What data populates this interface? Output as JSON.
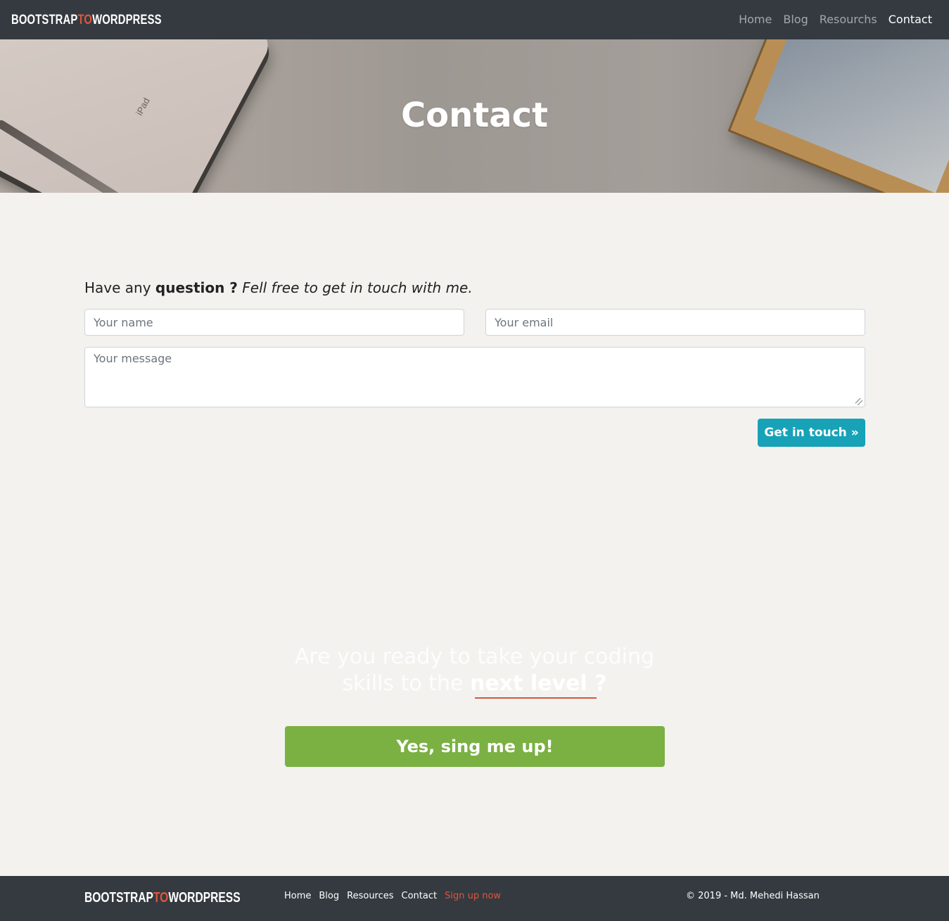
{
  "navbar": {
    "brand_part1": "BOOTSTRAP",
    "brand_accent": "TO",
    "brand_part2": "WORDPRESS",
    "links": [
      {
        "label": "Home"
      },
      {
        "label": "Blog"
      },
      {
        "label": "Resourchs"
      },
      {
        "label": "Contact",
        "active": true
      }
    ]
  },
  "hero": {
    "title": "Contact",
    "ipad_text": "iPad"
  },
  "contact": {
    "intro_prefix": "Have any ",
    "intro_bold": "question ?",
    "intro_italic": " Fell free to get in touch with me.",
    "name_placeholder": "Your name",
    "email_placeholder": "Your email",
    "message_placeholder": "Your message",
    "submit_label": "Get in touch »"
  },
  "cta": {
    "line1": "Are you ready to take your coding",
    "line2_prefix": "skills to the ",
    "line2_bold": "next level ?",
    "button_label": "Yes, sing me up!"
  },
  "footer": {
    "brand_part1": "BOOTSTRAP",
    "brand_accent": "TO",
    "brand_part2": "WORDPRESS",
    "links": [
      {
        "label": "Home"
      },
      {
        "label": "Blog"
      },
      {
        "label": "Resources"
      },
      {
        "label": "Contact"
      },
      {
        "label": "Sign up now",
        "highlight": true
      }
    ],
    "copyright": "© 2019 - Md. Mehedi Hassan"
  },
  "colors": {
    "navbar_bg": "#343a40",
    "accent_red": "#e0553b",
    "button_teal": "#17a2b8",
    "button_green": "#7ab142"
  }
}
